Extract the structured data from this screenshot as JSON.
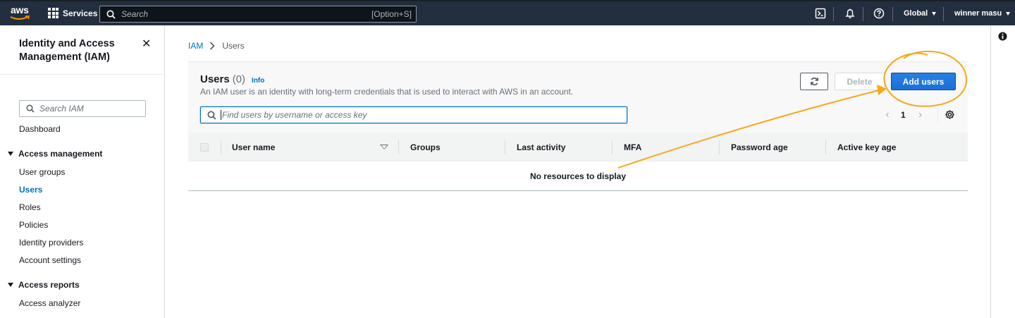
{
  "topnav": {
    "logo": "aws",
    "services_label": "Services",
    "search_placeholder": "Search",
    "search_shortcut": "[Option+S]",
    "icons": [
      "cloudshell-icon",
      "bell-icon",
      "help-icon"
    ],
    "region": "Global",
    "user": "winner masu"
  },
  "sidebar": {
    "title": "Identity and Access Management (IAM)",
    "search_placeholder": "Search IAM",
    "dashboard": "Dashboard",
    "sections": [
      {
        "label": "Access management",
        "items": [
          "User groups",
          "Users",
          "Roles",
          "Policies",
          "Identity providers",
          "Account settings"
        ]
      },
      {
        "label": "Access reports",
        "items": [
          "Access analyzer"
        ]
      }
    ],
    "active_item": "Users"
  },
  "breadcrumb": {
    "root": "IAM",
    "current": "Users"
  },
  "users_panel": {
    "title": "Users",
    "count": "(0)",
    "info": "Info",
    "description": "An IAM user is an identity with long-term credentials that is used to interact with AWS in an account.",
    "delete_label": "Delete",
    "add_label": "Add users",
    "search_placeholder": "Find users by username or access key",
    "page": "1",
    "columns": [
      "User name",
      "Groups",
      "Last activity",
      "MFA",
      "Password age",
      "Active key age"
    ],
    "empty_text": "No resources to display"
  },
  "colors": {
    "nav_bg": "#232f3e",
    "link": "#0073bb",
    "primary_button": "#1a73e8",
    "annotation": "#f7a81c"
  }
}
